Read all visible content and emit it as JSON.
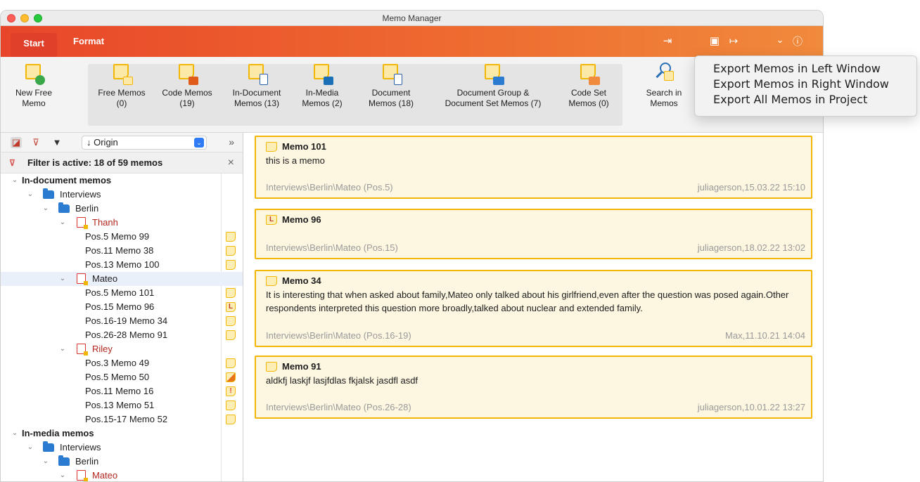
{
  "window": {
    "title": "Memo Manager"
  },
  "ribbon": {
    "tabs": [
      "Start",
      "Format"
    ],
    "buttons": [
      {
        "label1": "New Free",
        "label2": "Memo"
      },
      {
        "label1": "Free Memos",
        "label2": "(0)"
      },
      {
        "label1": "Code Memos",
        "label2": "(19)"
      },
      {
        "label1": "In-Document",
        "label2": "Memos (13)"
      },
      {
        "label1": "In-Media",
        "label2": "Memos (2)"
      },
      {
        "label1": "Document",
        "label2": "Memos (18)"
      },
      {
        "label1": "Document Group &",
        "label2": "Document Set Memos (7)"
      },
      {
        "label1": "Code Set",
        "label2": "Memos (0)"
      },
      {
        "label1": "Search in",
        "label2": "Memos"
      }
    ]
  },
  "export_menu": {
    "items": [
      "Export Memos in Left Window",
      "Export Memos in Right Window",
      "Export All Memos in Project"
    ]
  },
  "left": {
    "sort_value": "↓ Origin",
    "filter_text": "Filter is active: 18 of 59 memos",
    "tree": [
      {
        "text": "In-document memos"
      },
      {
        "text": "Interviews"
      },
      {
        "text": "Berlin"
      },
      {
        "text": "Thanh"
      },
      {
        "text": "Pos.5  Memo 99"
      },
      {
        "text": "Pos.11  Memo 38"
      },
      {
        "text": "Pos.13  Memo 100"
      },
      {
        "text": "Mateo"
      },
      {
        "text": "Pos.5  Memo 101"
      },
      {
        "text": "Pos.15  Memo 96"
      },
      {
        "text": "Pos.16-19  Memo 34"
      },
      {
        "text": "Pos.26-28  Memo 91"
      },
      {
        "text": "Riley"
      },
      {
        "text": "Pos.3  Memo 49"
      },
      {
        "text": "Pos.5  Memo 50"
      },
      {
        "text": "Pos.11  Memo 16"
      },
      {
        "text": "Pos.13  Memo 51"
      },
      {
        "text": "Pos.15-17  Memo 52"
      },
      {
        "text": "In-media memos"
      },
      {
        "text": "Interviews"
      },
      {
        "text": "Berlin"
      },
      {
        "text": "Mateo"
      }
    ],
    "memo_badges": [
      "L",
      "!"
    ]
  },
  "memos": [
    {
      "title": "Memo 101",
      "body": "this is a memo",
      "source": "Interviews\\Berlin\\Mateo (Pos.5)",
      "meta": "juliagerson,15.03.22 15:10",
      "badge": ""
    },
    {
      "title": "Memo 96",
      "body": "",
      "source": "Interviews\\Berlin\\Mateo (Pos.15)",
      "meta": "juliagerson,18.02.22 13:02",
      "badge": "L"
    },
    {
      "title": "Memo 34",
      "body": "It is interesting that when asked about family,Mateo only talked about his girlfriend,even after the question was posed again.Other respondents interpreted this question more broadly,talked about nuclear and extended family.",
      "source": "Interviews\\Berlin\\Mateo (Pos.16-19)",
      "meta": "Max,11.10.21 14:04",
      "badge": ""
    },
    {
      "title": "Memo 91",
      "body": "aldkfj laskjf lasjfdlas fkjalsk jasdfl asdf",
      "source": "Interviews\\Berlin\\Mateo (Pos.26-28)",
      "meta": "juliagerson,10.01.22 13:27",
      "badge": ""
    }
  ]
}
